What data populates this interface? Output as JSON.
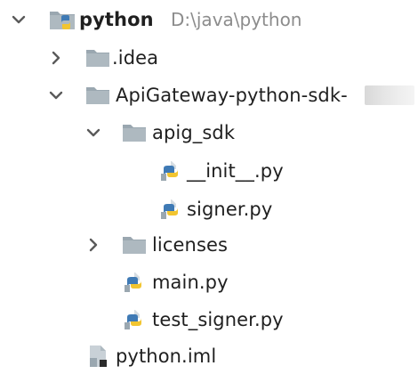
{
  "tree": {
    "root": {
      "label": "python",
      "path": "D:\\java\\python",
      "expanded": true
    },
    "idea": {
      "label": ".idea",
      "expanded": false
    },
    "sdk": {
      "label": "ApiGateway-python-sdk-",
      "expanded": true
    },
    "apig_sdk": {
      "label": "apig_sdk",
      "expanded": true
    },
    "init_py": {
      "label": "__init__.py"
    },
    "signer_py": {
      "label": "signer.py"
    },
    "licenses": {
      "label": "licenses",
      "expanded": false
    },
    "main_py": {
      "label": "main.py"
    },
    "test_signer_py": {
      "label": "test_signer.py"
    },
    "python_iml": {
      "label": "python.iml"
    }
  },
  "colors": {
    "folder": "#aeb9c0",
    "folder_dark": "#9aa7b0",
    "python_blue": "#3f7ab5",
    "python_yellow": "#f2c530",
    "text": "#1f1f1f",
    "path_gray": "#8c8c8c",
    "chevron": "#5a5a5a"
  },
  "icons": {
    "expanded": "chevron-down-icon",
    "collapsed": "chevron-right-icon",
    "folder": "folder-icon",
    "python_package": "python-package-folder-icon",
    "python_file": "python-file-icon",
    "iml_file": "iml-file-icon"
  }
}
